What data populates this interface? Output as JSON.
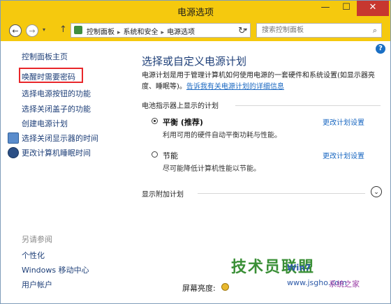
{
  "window": {
    "title": "电源选项",
    "minimize_glyph": "—",
    "maximize_glyph": "☐",
    "close_glyph": "✕"
  },
  "addressbar": {
    "back_glyph": "←",
    "forward_glyph": "→",
    "dropdown_glyph": "▾",
    "up_glyph": "↑",
    "refresh_glyph": "↻",
    "crumbs": [
      "控制面板",
      "系统和安全",
      "电源选项"
    ],
    "crumb_separator": "▸",
    "search_placeholder": "搜索控制面板",
    "search_icon_glyph": "⌕"
  },
  "help_glyph": "?",
  "sidebar": {
    "home_link": "控制面板主页",
    "links": [
      {
        "label": "唤醒时需要密码",
        "icon": null,
        "highlighted": true
      },
      {
        "label": "选择电源按钮的功能",
        "icon": null
      },
      {
        "label": "选择关闭盖子的功能",
        "icon": null
      },
      {
        "label": "创建电源计划",
        "icon": null
      },
      {
        "label": "选择关闭显示器的时间",
        "icon": "display-icon"
      },
      {
        "label": "更改计算机睡眠时间",
        "icon": "moon-icon"
      }
    ],
    "see_also_label": "另请参阅",
    "see_also": [
      "个性化",
      "Windows 移动中心",
      "用户帐户"
    ]
  },
  "main": {
    "title": "选择或自定义电源计划",
    "description": "电源计划是用于管理计算机如何使用电源的一套硬件和系统设置(如显示器亮度、睡眠等)。",
    "description_link": "告诉我有关电源计划的详细信息",
    "group_label": "电池指示器上显示的计划",
    "plans": [
      {
        "name": "平衡 (推荐)",
        "description": "利用可用的硬件自动平衡功耗与性能。",
        "selected": true,
        "edit_label": "更改计划设置"
      },
      {
        "name": "节能",
        "description": "尽可能降低计算机性能以节能。",
        "selected": false,
        "edit_label": "更改计划设置"
      }
    ],
    "more_plans_label": "显示附加计划",
    "expand_glyph": "⌄"
  },
  "bottom": {
    "brightness_label": "屏幕亮度:"
  },
  "watermark": {
    "brand_text": "技术员联盟",
    "win_text": "Win7",
    "url_text": "www.jsgho.com",
    "house_text": "系统之家"
  },
  "colors": {
    "titlebar": "#f5c90e",
    "link": "#1e3f78",
    "highlight_box": "#e8262a"
  }
}
